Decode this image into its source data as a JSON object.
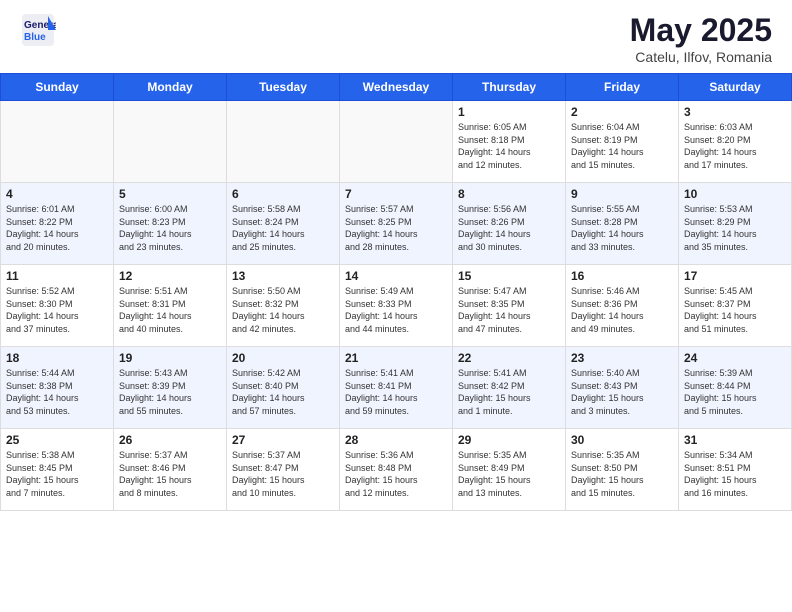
{
  "header": {
    "logo_general": "General",
    "logo_blue": "Blue",
    "title": "May 2025",
    "subtitle": "Catelu, Ilfov, Romania"
  },
  "calendar": {
    "days_of_week": [
      "Sunday",
      "Monday",
      "Tuesday",
      "Wednesday",
      "Thursday",
      "Friday",
      "Saturday"
    ],
    "weeks": [
      [
        {
          "day": "",
          "content": ""
        },
        {
          "day": "",
          "content": ""
        },
        {
          "day": "",
          "content": ""
        },
        {
          "day": "",
          "content": ""
        },
        {
          "day": "1",
          "content": "Sunrise: 6:05 AM\nSunset: 8:18 PM\nDaylight: 14 hours\nand 12 minutes."
        },
        {
          "day": "2",
          "content": "Sunrise: 6:04 AM\nSunset: 8:19 PM\nDaylight: 14 hours\nand 15 minutes."
        },
        {
          "day": "3",
          "content": "Sunrise: 6:03 AM\nSunset: 8:20 PM\nDaylight: 14 hours\nand 17 minutes."
        }
      ],
      [
        {
          "day": "4",
          "content": "Sunrise: 6:01 AM\nSunset: 8:22 PM\nDaylight: 14 hours\nand 20 minutes."
        },
        {
          "day": "5",
          "content": "Sunrise: 6:00 AM\nSunset: 8:23 PM\nDaylight: 14 hours\nand 23 minutes."
        },
        {
          "day": "6",
          "content": "Sunrise: 5:58 AM\nSunset: 8:24 PM\nDaylight: 14 hours\nand 25 minutes."
        },
        {
          "day": "7",
          "content": "Sunrise: 5:57 AM\nSunset: 8:25 PM\nDaylight: 14 hours\nand 28 minutes."
        },
        {
          "day": "8",
          "content": "Sunrise: 5:56 AM\nSunset: 8:26 PM\nDaylight: 14 hours\nand 30 minutes."
        },
        {
          "day": "9",
          "content": "Sunrise: 5:55 AM\nSunset: 8:28 PM\nDaylight: 14 hours\nand 33 minutes."
        },
        {
          "day": "10",
          "content": "Sunrise: 5:53 AM\nSunset: 8:29 PM\nDaylight: 14 hours\nand 35 minutes."
        }
      ],
      [
        {
          "day": "11",
          "content": "Sunrise: 5:52 AM\nSunset: 8:30 PM\nDaylight: 14 hours\nand 37 minutes."
        },
        {
          "day": "12",
          "content": "Sunrise: 5:51 AM\nSunset: 8:31 PM\nDaylight: 14 hours\nand 40 minutes."
        },
        {
          "day": "13",
          "content": "Sunrise: 5:50 AM\nSunset: 8:32 PM\nDaylight: 14 hours\nand 42 minutes."
        },
        {
          "day": "14",
          "content": "Sunrise: 5:49 AM\nSunset: 8:33 PM\nDaylight: 14 hours\nand 44 minutes."
        },
        {
          "day": "15",
          "content": "Sunrise: 5:47 AM\nSunset: 8:35 PM\nDaylight: 14 hours\nand 47 minutes."
        },
        {
          "day": "16",
          "content": "Sunrise: 5:46 AM\nSunset: 8:36 PM\nDaylight: 14 hours\nand 49 minutes."
        },
        {
          "day": "17",
          "content": "Sunrise: 5:45 AM\nSunset: 8:37 PM\nDaylight: 14 hours\nand 51 minutes."
        }
      ],
      [
        {
          "day": "18",
          "content": "Sunrise: 5:44 AM\nSunset: 8:38 PM\nDaylight: 14 hours\nand 53 minutes."
        },
        {
          "day": "19",
          "content": "Sunrise: 5:43 AM\nSunset: 8:39 PM\nDaylight: 14 hours\nand 55 minutes."
        },
        {
          "day": "20",
          "content": "Sunrise: 5:42 AM\nSunset: 8:40 PM\nDaylight: 14 hours\nand 57 minutes."
        },
        {
          "day": "21",
          "content": "Sunrise: 5:41 AM\nSunset: 8:41 PM\nDaylight: 14 hours\nand 59 minutes."
        },
        {
          "day": "22",
          "content": "Sunrise: 5:41 AM\nSunset: 8:42 PM\nDaylight: 15 hours\nand 1 minute."
        },
        {
          "day": "23",
          "content": "Sunrise: 5:40 AM\nSunset: 8:43 PM\nDaylight: 15 hours\nand 3 minutes."
        },
        {
          "day": "24",
          "content": "Sunrise: 5:39 AM\nSunset: 8:44 PM\nDaylight: 15 hours\nand 5 minutes."
        }
      ],
      [
        {
          "day": "25",
          "content": "Sunrise: 5:38 AM\nSunset: 8:45 PM\nDaylight: 15 hours\nand 7 minutes."
        },
        {
          "day": "26",
          "content": "Sunrise: 5:37 AM\nSunset: 8:46 PM\nDaylight: 15 hours\nand 8 minutes."
        },
        {
          "day": "27",
          "content": "Sunrise: 5:37 AM\nSunset: 8:47 PM\nDaylight: 15 hours\nand 10 minutes."
        },
        {
          "day": "28",
          "content": "Sunrise: 5:36 AM\nSunset: 8:48 PM\nDaylight: 15 hours\nand 12 minutes."
        },
        {
          "day": "29",
          "content": "Sunrise: 5:35 AM\nSunset: 8:49 PM\nDaylight: 15 hours\nand 13 minutes."
        },
        {
          "day": "30",
          "content": "Sunrise: 5:35 AM\nSunset: 8:50 PM\nDaylight: 15 hours\nand 15 minutes."
        },
        {
          "day": "31",
          "content": "Sunrise: 5:34 AM\nSunset: 8:51 PM\nDaylight: 15 hours\nand 16 minutes."
        }
      ]
    ]
  }
}
